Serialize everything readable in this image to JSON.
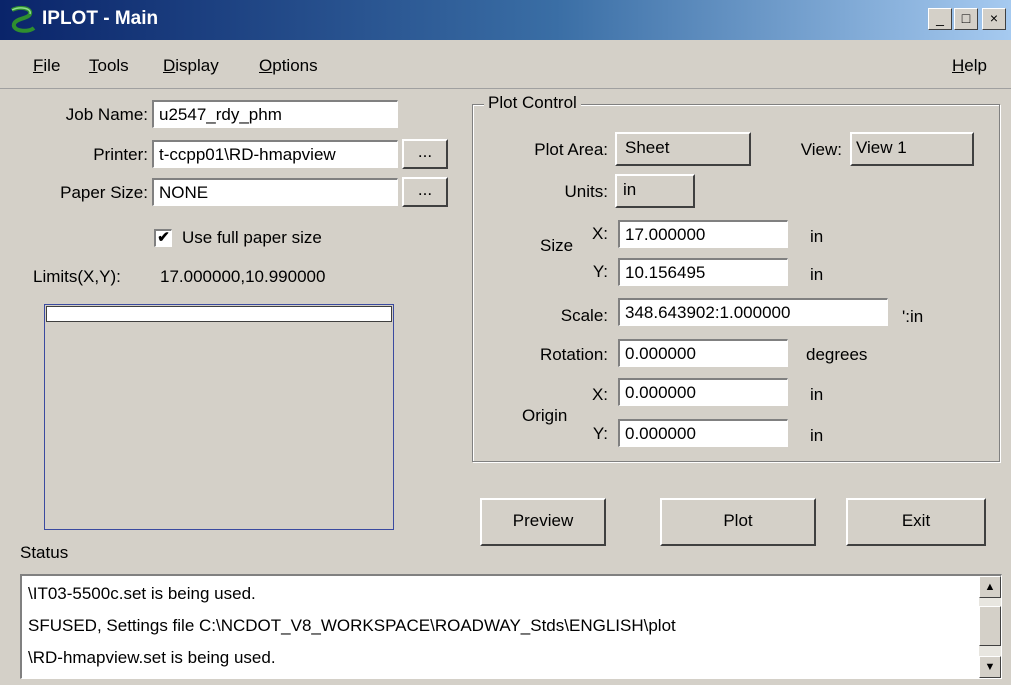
{
  "window": {
    "title": "IPLOT - Main",
    "buttons": {
      "minimize": "_",
      "maximize": "□",
      "close": "×"
    }
  },
  "menu": {
    "file": {
      "key": "F",
      "rest": "ile"
    },
    "tools": {
      "key": "T",
      "rest": "ools"
    },
    "display": {
      "key": "D",
      "rest": "isplay"
    },
    "options": {
      "key": "O",
      "rest": "ptions"
    },
    "help": {
      "key": "H",
      "rest": "elp"
    }
  },
  "job": {
    "job_name_label": "Job Name:",
    "job_name": "u2547_rdy_phm",
    "printer_label": "Printer:",
    "printer": "t-ccpp01\\RD-hmapview",
    "paper_size_label": "Paper Size:",
    "paper_size": "NONE",
    "browse_label": "...",
    "use_full_paper_label": "Use full paper size",
    "use_full_paper_checked": true,
    "limits_label": "Limits(X,Y):",
    "limits_value": "17.000000,10.990000"
  },
  "plot_control": {
    "title": "Plot Control",
    "plot_area_label": "Plot Area:",
    "plot_area": "Sheet",
    "view_label": "View:",
    "view": "View 1",
    "units_label": "Units:",
    "units": "in",
    "size_label": "Size",
    "x_label": "X:",
    "y_label": "Y:",
    "size_x": "17.000000",
    "size_y": "10.156495",
    "size_unit": "in",
    "scale_label": "Scale:",
    "scale": "348.643902:1.000000",
    "scale_unit": "':in",
    "rotation_label": "Rotation:",
    "rotation": "0.000000",
    "rotation_unit": "degrees",
    "origin_label": "Origin",
    "origin_x": "0.000000",
    "origin_y": "0.000000",
    "origin_unit": "in"
  },
  "actions": {
    "preview": "Preview",
    "plot": "Plot",
    "exit": "Exit"
  },
  "status": {
    "label": "Status",
    "lines": [
      "\\IT03-5500c.set is being used.",
      "SFUSED, Settings file C:\\NCDOT_V8_WORKSPACE\\ROADWAY_Stds\\ENGLISH\\plot",
      "\\RD-hmapview.set is being used."
    ]
  }
}
